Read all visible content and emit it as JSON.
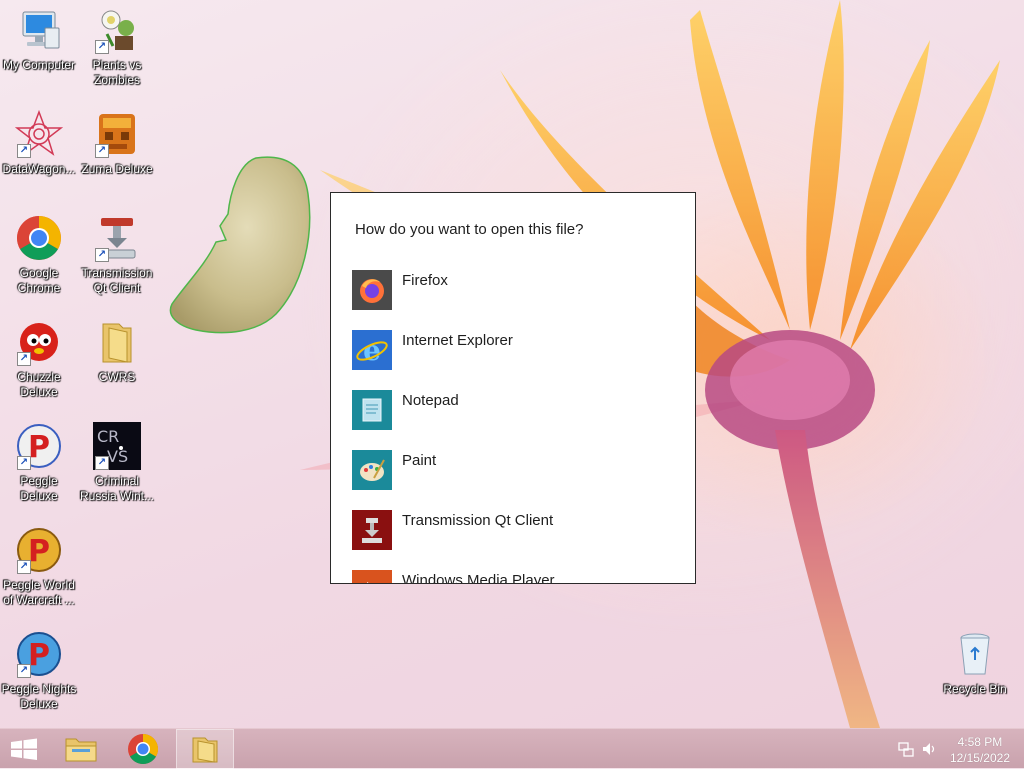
{
  "desktop": {
    "icons": [
      {
        "label": "My Computer"
      },
      {
        "label": "Plants vs Zombies"
      },
      {
        "label": "DataWagon..."
      },
      {
        "label": "Zuma Deluxe"
      },
      {
        "label": "Google Chrome"
      },
      {
        "label": "Transmission Qt Client"
      },
      {
        "label": "Chuzzle Deluxe"
      },
      {
        "label": "CWRS"
      },
      {
        "label": "Peggle Deluxe"
      },
      {
        "label": "Criminal Russia Wint..."
      },
      {
        "label": "Peggle World of Warcraft ..."
      },
      {
        "label": "Peggle Nights Deluxe"
      },
      {
        "label": "Recycle Bin"
      }
    ]
  },
  "dialog": {
    "title": "How do you want to open this file?",
    "apps": [
      {
        "name": "Firefox",
        "icon": "firefox-icon",
        "tile_color": "#4a4a4a"
      },
      {
        "name": "Internet Explorer",
        "icon": "internet-explorer-icon",
        "tile_color": "#2b6fd1"
      },
      {
        "name": "Notepad",
        "icon": "notepad-icon",
        "tile_color": "#1b8a9a"
      },
      {
        "name": "Paint",
        "icon": "paint-icon",
        "tile_color": "#1b8a9a"
      },
      {
        "name": "Transmission Qt Client",
        "icon": "transmission-icon",
        "tile_color": "#8a1010"
      },
      {
        "name": "Windows Media Player",
        "icon": "media-player-icon",
        "tile_color": "#d9531e"
      }
    ]
  },
  "taskbar": {
    "items": [
      {
        "name": "start-button",
        "icon": "windows-logo-icon"
      },
      {
        "name": "file-explorer",
        "icon": "folder-icon"
      },
      {
        "name": "google-chrome",
        "icon": "chrome-icon"
      },
      {
        "name": "open-folder-window",
        "icon": "folder-icon"
      }
    ],
    "clock_time": "4:58 PM",
    "clock_date": "12/15/2022"
  }
}
